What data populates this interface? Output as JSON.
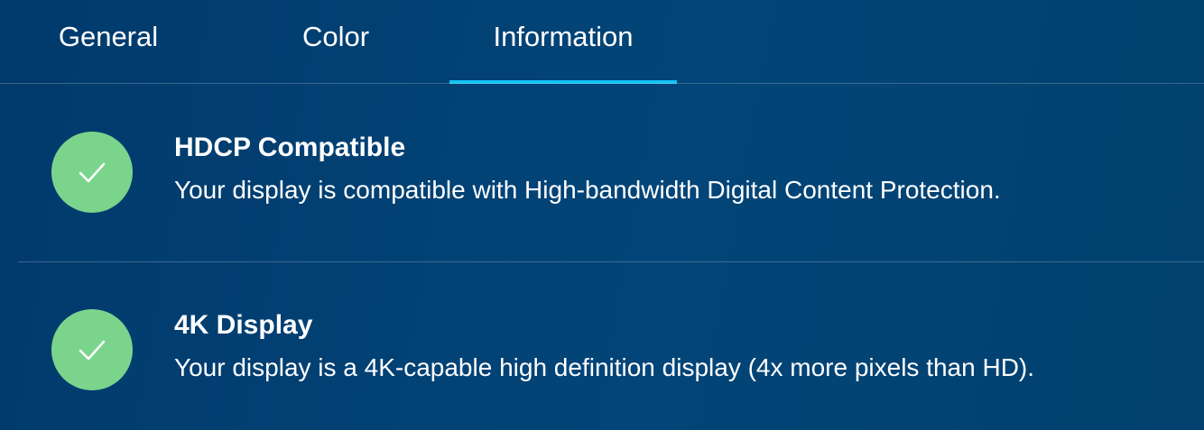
{
  "tabs": [
    {
      "label": "General",
      "active": false
    },
    {
      "label": "Color",
      "active": false
    },
    {
      "label": "Information",
      "active": true
    }
  ],
  "colors": {
    "background": "#01396b",
    "accent": "#12c3f4",
    "success": "#7bd48c"
  },
  "items": [
    {
      "icon": "check-circle-icon",
      "title": "HDCP Compatible",
      "description": "Your display is compatible with High-bandwidth Digital Content Protection."
    },
    {
      "icon": "check-circle-icon",
      "title": "4K Display",
      "description": "Your display is a 4K-capable high definition display (4x more pixels than HD)."
    }
  ]
}
